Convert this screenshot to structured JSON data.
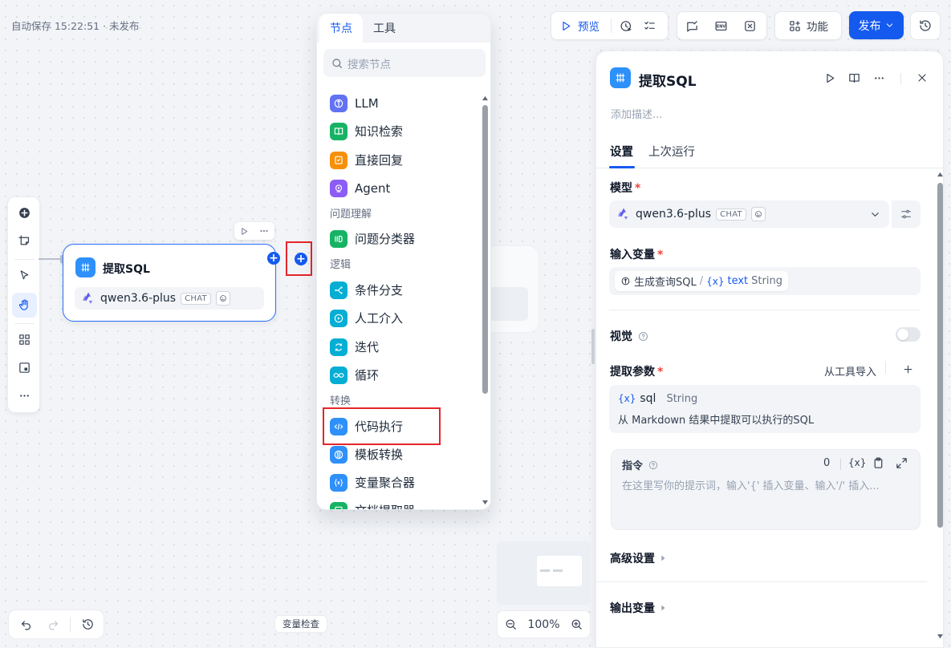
{
  "status": {
    "autosave": "自动保存 15:22:51 · 未发布"
  },
  "toolbar": {
    "preview": "预览",
    "features": "功能",
    "publish": "发布",
    "env_label": "ENV"
  },
  "canvas": {
    "node": {
      "title": "提取SQL",
      "model": "qwen3.6-plus",
      "model_badge": "CHAT"
    }
  },
  "picker": {
    "tabs": [
      "节点",
      "工具"
    ],
    "search_placeholder": "搜索节点",
    "items": {
      "llm": "LLM",
      "knowledge": "知识检索",
      "answer": "直接回复",
      "agent": "Agent",
      "group_qu": "问题理解",
      "classifier": "问题分类器",
      "group_logic": "逻辑",
      "ifelse": "条件分支",
      "human": "人工介入",
      "iteration": "迭代",
      "loop": "循环",
      "group_transform": "转换",
      "code": "代码执行",
      "template": "模板转换",
      "aggregator": "变量聚合器",
      "doc_extractor": "文档提取器"
    }
  },
  "panel": {
    "title": "提取SQL",
    "description_placeholder": "添加描述...",
    "tabs": {
      "settings": "设置",
      "last_run": "上次运行"
    },
    "model_label": "模型",
    "model_name": "qwen3.6-plus",
    "model_badge": "CHAT",
    "input_label": "输入变量",
    "input_var": {
      "node": "生成查询SQL",
      "sep": "/",
      "var_prefix": "{x}",
      "name": "text",
      "type": "String"
    },
    "vision_label": "视觉",
    "params_label": "提取参数",
    "import_from_tool": "从工具导入",
    "param": {
      "prefix": "{x}",
      "name": "sql",
      "type": "String",
      "description": "从 Markdown 结果中提取可以执行的SQL"
    },
    "instruction": {
      "label": "指令",
      "count": "0",
      "var_btn": "{x}",
      "placeholder": "在这里写你的提示词，输入'{' 插入变量、输入'/' 插入..."
    },
    "advanced": "高级设置",
    "output": "输出变量"
  },
  "bottom": {
    "var_check": "变量检查",
    "zoom": "100%"
  },
  "colors": {
    "accent": "#155aef",
    "node_blue": "#2e90fa",
    "highlight": "#e5252a"
  }
}
